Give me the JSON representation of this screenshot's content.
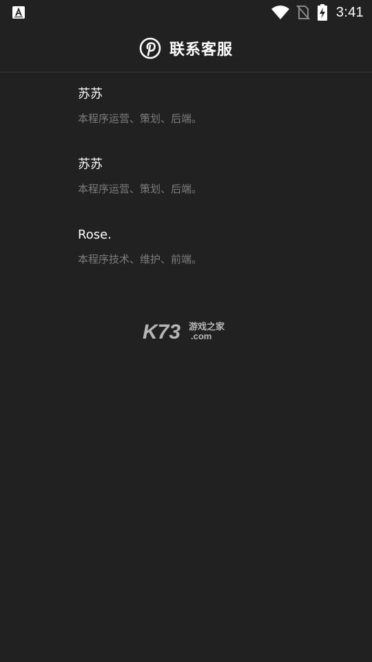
{
  "status_bar": {
    "time": "3:41",
    "icons": [
      "app-a-icon",
      "wifi-icon",
      "no-sim-icon",
      "battery-charging-icon"
    ]
  },
  "header": {
    "title": "联系客服",
    "logo_icon": "pinterest-p-icon"
  },
  "contacts": [
    {
      "name": "苏苏",
      "role": "本程序运营、策划、后端。"
    },
    {
      "name": "苏苏",
      "role": "本程序运营、策划、后端。"
    },
    {
      "name": "Rose.",
      "role": "本程序技术、维护、前端。"
    }
  ],
  "watermark": {
    "brand": "K73",
    "tagline": "游戏之家",
    "domain": ".com"
  },
  "colors": {
    "background": "#212121",
    "text_primary": "#ffffff",
    "text_secondary": "#7d7d7d",
    "divider": "#3a3a3a"
  }
}
